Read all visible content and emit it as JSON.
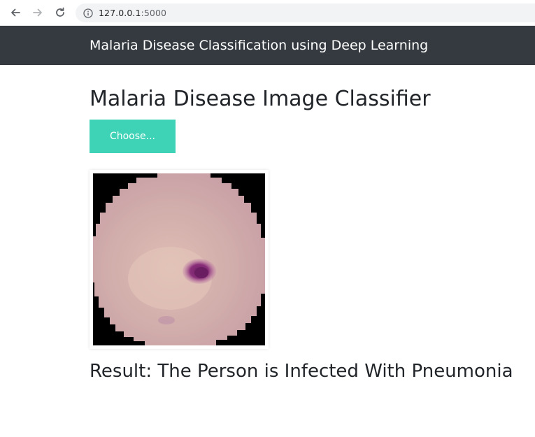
{
  "browser": {
    "url_host": "127.0.0.1",
    "url_port": ":5000"
  },
  "navbar": {
    "brand": "Malaria Disease Classification using Deep Learning"
  },
  "main": {
    "title": "Malaria Disease Image Classifier",
    "choose_button_label": "Choose...",
    "result": "Result: The Person is Infected With Pneumonia"
  },
  "colors": {
    "navbar_bg": "#343a40",
    "choose_button_bg": "#3ed3b6",
    "cell_fill": "#cfa9a9",
    "parasite": "#8a2f7a"
  }
}
